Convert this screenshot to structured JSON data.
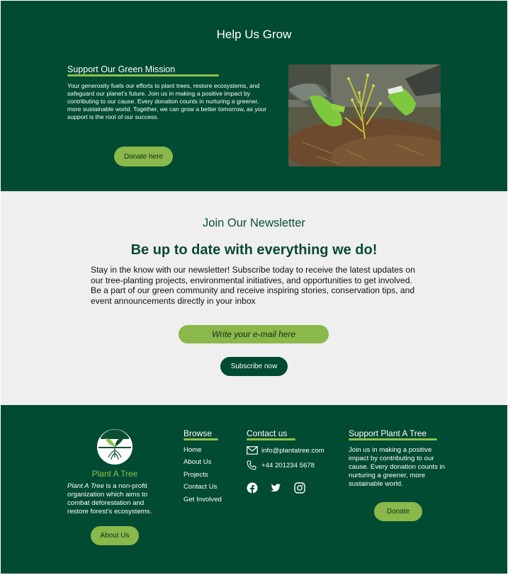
{
  "hero": {
    "title": "Help Us Grow",
    "mission_heading": "Support Our Green Mission",
    "mission_text": "Your generosity fuels our efforts to plant trees, restore ecosystems, and safeguard our planet's future. Join us in making a positive impact by contributing to our cause. Every donation counts in nurturing a greener, more sustainable world. Together, we can grow a better tomorrow, as your support is the root of our success.",
    "donate_label": "Donate here"
  },
  "newsletter": {
    "title": "Join Our Newsletter",
    "headline": "Be up to date with everything we do!",
    "body": "Stay in the know with our newsletter! Subscribe today to receive the latest updates on our tree-planting projects, environmental initiatives, and opportunities to get involved. Be a part of our green community and receive inspiring stories, conservation tips, and event announcements directly in your inbox",
    "email_placeholder": "Write your e-mail here",
    "subscribe_label": "Subscribe now"
  },
  "footer": {
    "brand_name": "Plant A Tree",
    "brand_name_italic": "Plant A Tree",
    "brand_desc": " is a non-profit organization which aims to combat deforestation and restore forest’s ecosystems.",
    "about_label": "About Us",
    "browse": {
      "heading": "Browse",
      "items": [
        "Home",
        "About Us",
        "Projects",
        "Contact Us",
        "Get Involved"
      ]
    },
    "contact": {
      "heading": "Contact us",
      "email": "info@plantatree.com",
      "phone": "+44 201234 5678",
      "socials": [
        "facebook-icon",
        "twitter-icon",
        "instagram-icon"
      ]
    },
    "support": {
      "heading": "Support Plant A Tree",
      "text": "Join us in making a positive impact by contributing to our cause. Every donation counts in nurturing a greener, more sustainable world.",
      "donate_label": "Donate"
    }
  },
  "colors": {
    "dark_green": "#024b33",
    "accent_green": "#8ab84a",
    "light_bg": "#efefef"
  }
}
